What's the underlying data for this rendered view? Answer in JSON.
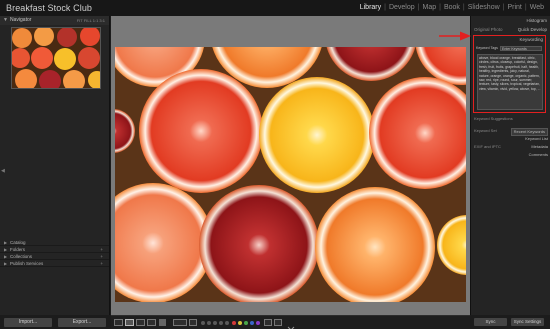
{
  "app": {
    "title": "Breakfast Stock Club"
  },
  "modules": [
    "Library",
    "Develop",
    "Map",
    "Book",
    "Slideshow",
    "Print",
    "Web"
  ],
  "active_module": "Library",
  "left_panel": {
    "navigator": {
      "label": "Navigator",
      "options": "FIT FILL 1:1 3:1"
    },
    "sections": [
      "Catalog",
      "Folders",
      "Collections",
      "Publish Services"
    ],
    "buttons": {
      "import": "Import...",
      "export": "Export..."
    }
  },
  "right_panel": {
    "histogram": "Histogram",
    "quick_develop": {
      "label": "Quick Develop",
      "preset": "Original Photo"
    },
    "keywording": {
      "label": "Keywording",
      "tags_label": "Keyword Tags",
      "tags_mode": "Enter Keywords",
      "keywords": "above, blood orange, breakfast, citric, circles, citrus, closeup, colorful, design, fresh, fruit, fruits, grapefruit, half, health, healthy, ingredients, juicy, natural, nature, orange, orange, organic, pattern, raw, red, ripe, round, sour, summer, texture, tasty, slices, tropical, vegetarian, view, vitamin, vivid, yellow, above, top, ..."
    },
    "keyword_suggestions": "Keyword Suggestions",
    "keyword_set": {
      "label": "Keyword Set",
      "value": "Recent Keywords"
    },
    "keyword_list": "Keyword List",
    "metadata": {
      "label": "Metadata",
      "preset": "EXIF and IPTC"
    },
    "comments": "Comments",
    "buttons": {
      "sync": "Sync",
      "sync_settings": "Sync Settings"
    }
  },
  "colors": {
    "annotation": "#e32020",
    "panel": "#242424",
    "workspace": "#7a7a7a"
  }
}
